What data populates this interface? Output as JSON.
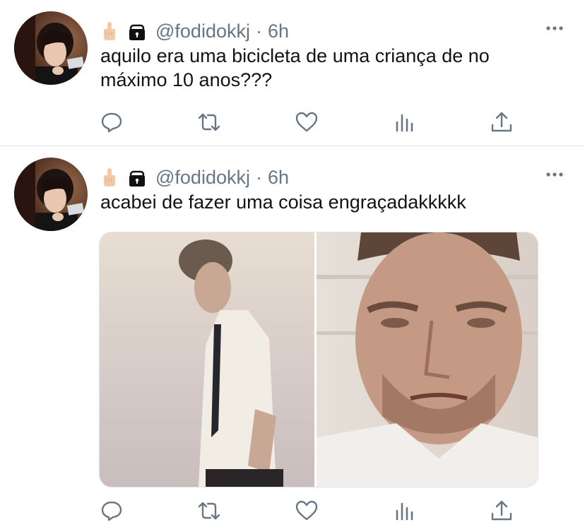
{
  "tweets": [
    {
      "handle": "@fodidokkj",
      "separator": "·",
      "time": "6h",
      "text": "aquilo era uma bicicleta de uma criança de no máximo 10 anos???",
      "has_media": false
    },
    {
      "handle": "@fodidokkj",
      "separator": "·",
      "time": "6h",
      "text": "acabei de fazer uma coisa engraçadakkkkk",
      "has_media": true
    }
  ],
  "icons": {
    "name_emoji_1": "middle-finger-emoji",
    "name_emoji_2": "lock-icon",
    "more": "more-dots-icon",
    "actions": [
      "reply-icon",
      "retweet-icon",
      "like-icon",
      "analytics-icon",
      "share-icon"
    ]
  },
  "colors": {
    "text": "#0f1419",
    "secondary": "#687684",
    "divider": "#e1e6ea"
  }
}
